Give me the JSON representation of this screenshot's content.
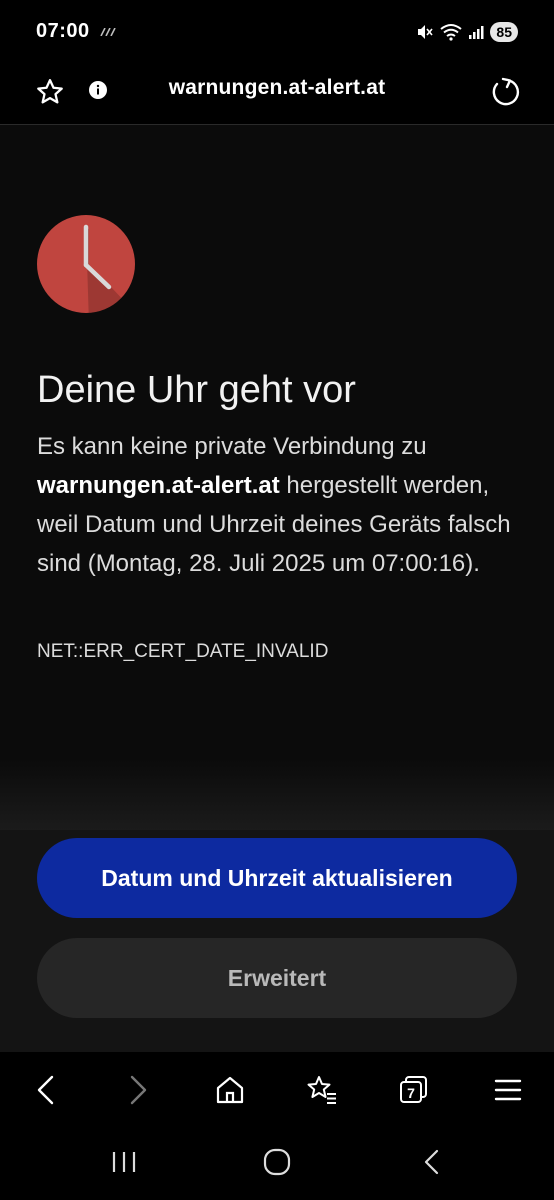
{
  "status_bar": {
    "time": "07:00",
    "battery": "85"
  },
  "browser": {
    "url": "warnungen.at-alert.at"
  },
  "error_page": {
    "title": "Deine Uhr geht vor",
    "description_before": "Es kann keine private Verbindung zu ",
    "description_domain": "warnungen.at-alert.at",
    "description_after": " hergestellt werden, weil Datum und Uhrzeit deines Geräts falsch sind (Montag, 28. Juli 2025 um 07:00:16).",
    "error_code": "NET::ERR_CERT_DATE_INVALID",
    "icon": "clock-icon",
    "icon_color": "#c0453f"
  },
  "actions": {
    "primary_label": "Datum und Uhrzeit aktualisieren",
    "primary_color": "#0d2aa0",
    "secondary_label": "Erweitert"
  },
  "toolbar": {
    "tab_count": "7",
    "icons": [
      "back-icon",
      "forward-icon",
      "home-icon",
      "bookmarks-icon",
      "tabs-icon",
      "menu-icon"
    ]
  },
  "system_nav": {
    "icons": [
      "recent-apps-icon",
      "home-circle-icon",
      "system-back-icon"
    ]
  }
}
